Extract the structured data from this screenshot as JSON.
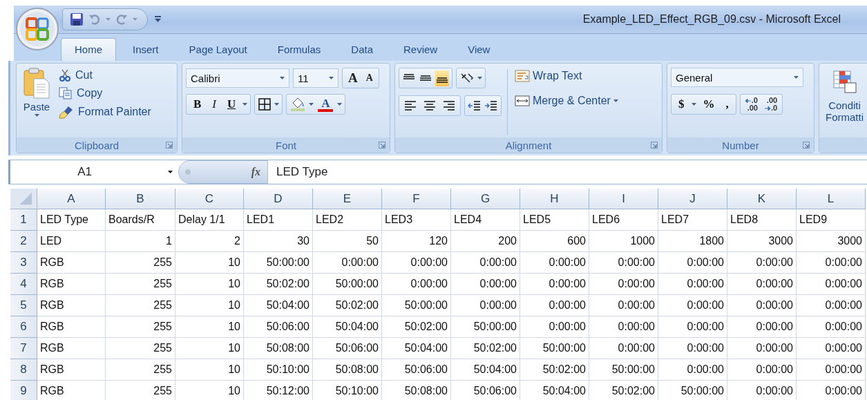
{
  "window": {
    "title": "Example_LED_Effect_RGB_09.csv - Microsoft Excel"
  },
  "tabs": [
    {
      "label": "Home",
      "selected": true
    },
    {
      "label": "Insert",
      "selected": false
    },
    {
      "label": "Page Layout",
      "selected": false
    },
    {
      "label": "Formulas",
      "selected": false
    },
    {
      "label": "Data",
      "selected": false
    },
    {
      "label": "Review",
      "selected": false
    },
    {
      "label": "View",
      "selected": false
    }
  ],
  "ribbon": {
    "clipboard": {
      "label": "Clipboard",
      "paste": "Paste",
      "items": [
        {
          "kind": "cut",
          "label": "Cut"
        },
        {
          "kind": "copy",
          "label": "Copy"
        },
        {
          "kind": "painter",
          "label": "Format Painter"
        }
      ]
    },
    "font": {
      "label": "Font",
      "font_name": "Calibri",
      "font_size": "11",
      "size_buttons": [
        {
          "kind": "grow",
          "glyph": "A"
        },
        {
          "kind": "shrink",
          "glyph": "A"
        }
      ],
      "style_buttons": [
        {
          "kind": "bold",
          "glyph": "B"
        },
        {
          "kind": "italic",
          "glyph": "I"
        },
        {
          "kind": "underline",
          "glyph": "U"
        }
      ],
      "font_color_glyph": "A"
    },
    "alignment": {
      "label": "Alignment",
      "vertical": [
        {
          "kind": "top",
          "selected": false
        },
        {
          "kind": "middle",
          "selected": false
        },
        {
          "kind": "bottom",
          "selected": true
        }
      ],
      "horizontal": [
        {
          "kind": "left"
        },
        {
          "kind": "center"
        },
        {
          "kind": "right"
        }
      ],
      "wrap_text": "Wrap Text",
      "merge_center": "Merge & Center"
    },
    "number": {
      "label": "Number",
      "format": "General",
      "symbols": [
        "$",
        "%",
        ","
      ],
      "decimals": [
        {
          "kind": "increase",
          "top": ".0",
          "bottom": ".00"
        },
        {
          "kind": "decrease",
          "top": ".00",
          "bottom": ".0"
        }
      ]
    },
    "styles": {
      "label_lines": [
        "Conditi",
        "Formatti"
      ]
    }
  },
  "formula_bar": {
    "name_box": "A1",
    "function_symbol": "fx",
    "formula": "LED Type"
  },
  "sheet": {
    "columns": [
      {
        "letter": "A"
      },
      {
        "letter": "B"
      },
      {
        "letter": "C"
      },
      {
        "letter": "D"
      },
      {
        "letter": "E"
      },
      {
        "letter": "F"
      },
      {
        "letter": "G"
      },
      {
        "letter": "H"
      },
      {
        "letter": "I"
      },
      {
        "letter": "J"
      },
      {
        "letter": "K"
      },
      {
        "letter": "L"
      }
    ],
    "rows": [
      {
        "number": "1",
        "kind": "text",
        "cells": [
          "LED Type",
          "Boards/R",
          "Delay 1/1",
          "LED1",
          "LED2",
          "LED3",
          "LED4",
          "LED5",
          "LED6",
          "LED7",
          "LED8",
          "LED9"
        ]
      },
      {
        "number": "2",
        "kind": "values",
        "cells": [
          "LED",
          "1",
          "2",
          "30",
          "50",
          "120",
          "200",
          "600",
          "1000",
          "1800",
          "3000",
          "3000"
        ]
      },
      {
        "number": "3",
        "kind": "values",
        "cells": [
          "RGB",
          "255",
          "10",
          "50:00:00",
          "0:00:00",
          "0:00:00",
          "0:00:00",
          "0:00:00",
          "0:00:00",
          "0:00:00",
          "0:00:00",
          "0:00:00"
        ]
      },
      {
        "number": "4",
        "kind": "values",
        "cells": [
          "RGB",
          "255",
          "10",
          "50:02:00",
          "50:00:00",
          "0:00:00",
          "0:00:00",
          "0:00:00",
          "0:00:00",
          "0:00:00",
          "0:00:00",
          "0:00:00"
        ]
      },
      {
        "number": "5",
        "kind": "values",
        "cells": [
          "RGB",
          "255",
          "10",
          "50:04:00",
          "50:02:00",
          "50:00:00",
          "0:00:00",
          "0:00:00",
          "0:00:00",
          "0:00:00",
          "0:00:00",
          "0:00:00"
        ]
      },
      {
        "number": "6",
        "kind": "values",
        "cells": [
          "RGB",
          "255",
          "10",
          "50:06:00",
          "50:04:00",
          "50:02:00",
          "50:00:00",
          "0:00:00",
          "0:00:00",
          "0:00:00",
          "0:00:00",
          "0:00:00"
        ]
      },
      {
        "number": "7",
        "kind": "values",
        "cells": [
          "RGB",
          "255",
          "10",
          "50:08:00",
          "50:06:00",
          "50:04:00",
          "50:02:00",
          "50:00:00",
          "0:00:00",
          "0:00:00",
          "0:00:00",
          "0:00:00"
        ]
      },
      {
        "number": "8",
        "kind": "values",
        "cells": [
          "RGB",
          "255",
          "10",
          "50:10:00",
          "50:08:00",
          "50:06:00",
          "50:04:00",
          "50:02:00",
          "50:00:00",
          "0:00:00",
          "0:00:00",
          "0:00:00"
        ]
      },
      {
        "number": "9",
        "kind": "values",
        "cells": [
          "RGB",
          "255",
          "10",
          "50:12:00",
          "50:10:00",
          "50:08:00",
          "50:06:00",
          "50:04:00",
          "50:02:00",
          "50:00:00",
          "0:00:00",
          "0:00:00"
        ]
      }
    ]
  }
}
